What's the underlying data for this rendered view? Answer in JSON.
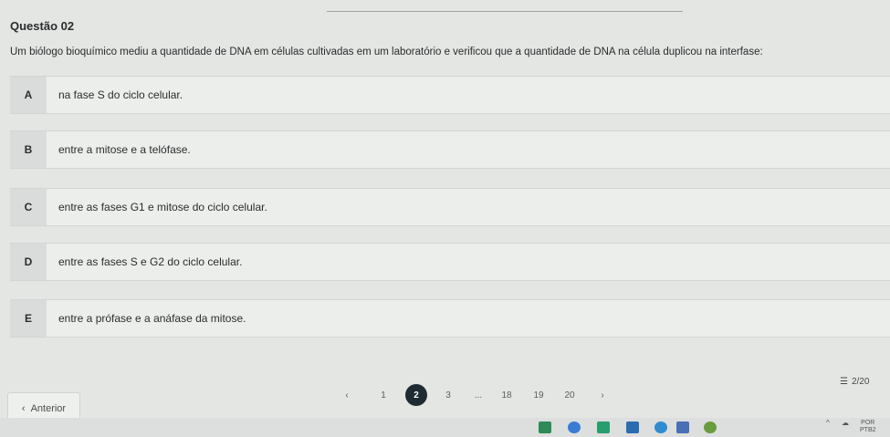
{
  "question": {
    "title": "Questão 02",
    "text": "Um biólogo bioquímico mediu a quantidade de DNA em células cultivadas em um laboratório e verificou que a quantidade de DNA na célula duplicou na interfase:"
  },
  "options": [
    {
      "letter": "A",
      "text": "na fase S do ciclo celular."
    },
    {
      "letter": "B",
      "text": "entre a mitose e a telófase."
    },
    {
      "letter": "C",
      "text": "entre as fases G1 e mitose do ciclo celular."
    },
    {
      "letter": "D",
      "text": "entre as fases S e G2 do ciclo celular."
    },
    {
      "letter": "E",
      "text": "entre a prófase e a anáfase da mitose."
    }
  ],
  "nav": {
    "prev_label": "Anterior",
    "prev_icon": "chevron-left-icon",
    "pages": [
      "1",
      "2",
      "3",
      "...",
      "18",
      "19",
      "20"
    ],
    "current_page": "2",
    "counter": "2/20",
    "counter_icon": "list-icon"
  },
  "tray": {
    "lang_top": "POR",
    "lang_bottom": "PTB2"
  },
  "colors": {
    "background": "#e4e6e3",
    "option_bg": "#eceeeb",
    "letter_bg": "#d9dcda",
    "active_page": "#1f2b33"
  }
}
